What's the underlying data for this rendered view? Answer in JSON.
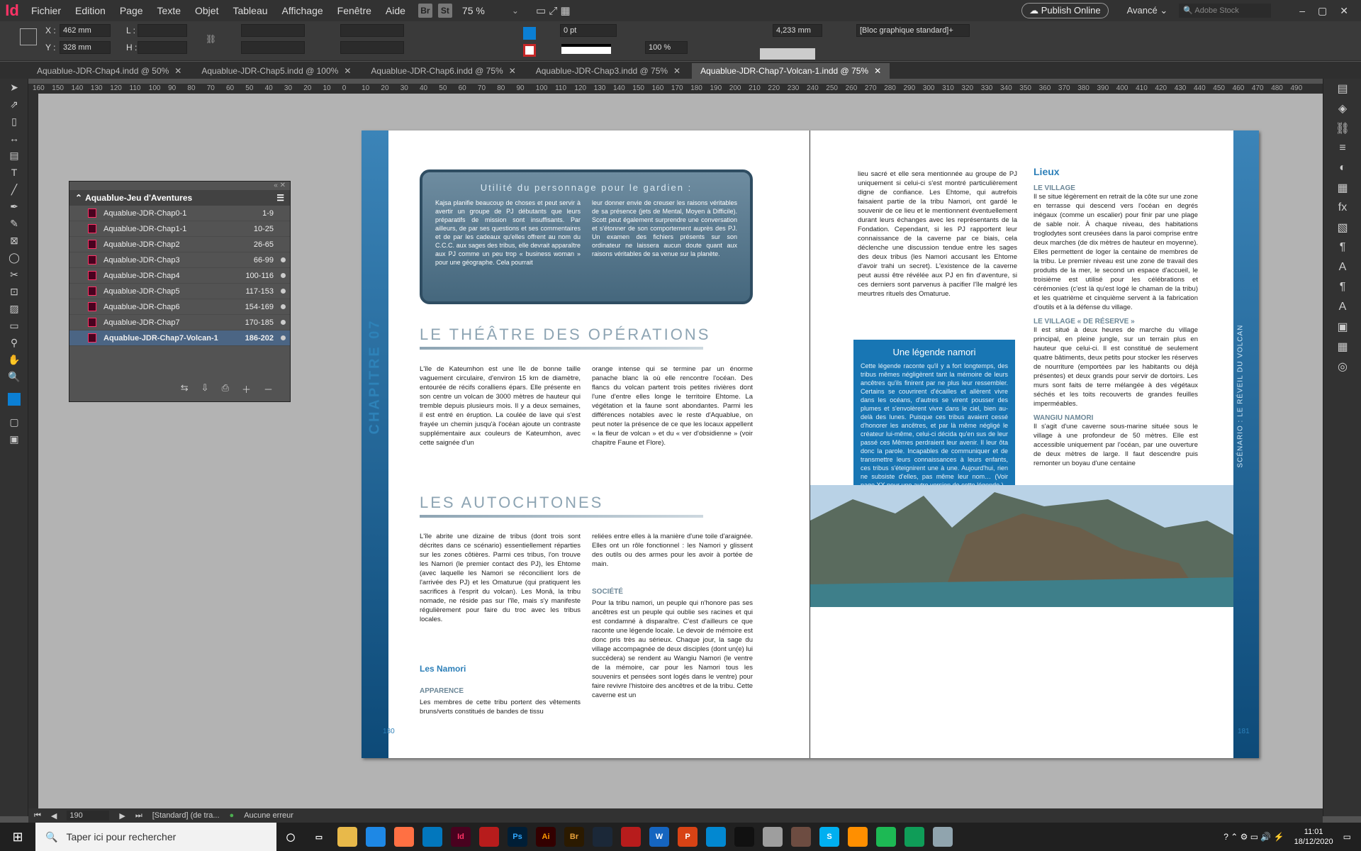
{
  "menubar": {
    "logo": "Id",
    "items": [
      "Fichier",
      "Edition",
      "Page",
      "Texte",
      "Objet",
      "Tableau",
      "Affichage",
      "Fenêtre",
      "Aide"
    ],
    "br": "Br",
    "st": "St",
    "zoom": "75 %",
    "publish": "Publish Online",
    "workspace": "Avancé",
    "stock_placeholder": "Adobe Stock"
  },
  "control": {
    "x_label": "X :",
    "x_value": "462 mm",
    "y_label": "Y :",
    "y_value": "328 mm",
    "w_label": "L :",
    "h_label": "H :",
    "stroke_weight": "0 pt",
    "scale": "100 %",
    "size_value": "4,233 mm",
    "style": "[Bloc graphique standard]+"
  },
  "tabs": [
    {
      "label": "Aquablue-JDR-Chap4.indd @ 50%"
    },
    {
      "label": "Aquablue-JDR-Chap5.indd @ 100%"
    },
    {
      "label": "Aquablue-JDR-Chap6.indd @ 75%"
    },
    {
      "label": "Aquablue-JDR-Chap3.indd @ 75%"
    },
    {
      "label": "Aquablue-JDR-Chap7-Volcan-1.indd @ 75%"
    }
  ],
  "ruler": [
    "160",
    "150",
    "140",
    "130",
    "120",
    "110",
    "100",
    "90",
    "80",
    "70",
    "60",
    "50",
    "40",
    "30",
    "20",
    "10",
    "0",
    "10",
    "20",
    "30",
    "40",
    "50",
    "60",
    "70",
    "80",
    "90",
    "100",
    "110",
    "120",
    "130",
    "140",
    "150",
    "160",
    "170",
    "180",
    "190",
    "200",
    "210",
    "220",
    "230",
    "240",
    "250",
    "260",
    "270",
    "280",
    "290",
    "300",
    "310",
    "320",
    "330",
    "340",
    "350",
    "360",
    "370",
    "380",
    "390",
    "400",
    "410",
    "420",
    "430",
    "440",
    "450",
    "460",
    "470",
    "480",
    "490"
  ],
  "book": {
    "title": "Aquablue-Jeu d'Aventures",
    "rows": [
      {
        "name": "Aquablue-JDR-Chap0-1",
        "pages": "1-9"
      },
      {
        "name": "Aquablue-JDR-Chap1-1",
        "pages": "10-25"
      },
      {
        "name": "Aquablue-JDR-Chap2",
        "pages": "26-65"
      },
      {
        "name": "Aquablue-JDR-Chap3",
        "pages": "66-99"
      },
      {
        "name": "Aquablue-JDR-Chap4",
        "pages": "100-116"
      },
      {
        "name": "Aquablue-JDR-Chap5",
        "pages": "117-153"
      },
      {
        "name": "Aquablue-JDR-Chap6",
        "pages": "154-169"
      },
      {
        "name": "Aquablue-JDR-Chap7",
        "pages": "170-185"
      },
      {
        "name": "Aquablue-JDR-Chap7-Volcan-1",
        "pages": "186-202"
      }
    ]
  },
  "page_left": {
    "chapter": "CHAPITRE 07",
    "box_title": "Utilité du personnage pour le gardien :",
    "box_col1": "Kajsa planifie beaucoup de choses et peut servir à avertir un groupe de PJ débutants que leurs préparatifs de mission sont insuffisants. Par ailleurs, de par ses questions et ses commentaires et de par les cadeaux qu'elles offrent au nom du C.C.C. aux sages des tribus, elle devrait apparaître aux PJ comme un peu trop « business woman » pour une géographe. Cela pourrait",
    "box_col2": "leur donner envie de creuser les raisons véritables de sa présence (jets de Mental, Moyen à Difficile). Scott peut également surprendre une conversation et s'étonner de son comportement auprès des PJ. Un examen des fichiers présents sur son ordinateur ne laissera aucun doute quant aux raisons véritables de sa venue sur la planète.",
    "h_theatre": "Le théâtre des opérations",
    "theatre_col1": "L'île de Kateumhon est une île de bonne taille vaguement circulaire, d'environ 15 km de diamètre, entourée de récifs coralliens épars. Elle présente en son centre un volcan de 3000 mètres de hauteur qui tremble depuis plusieurs mois. Il y a deux semaines, il est entré en éruption. La coulée de lave qui s'est frayée un chemin jusqu'à l'océan ajoute un contraste supplémentaire aux couleurs de Kateumhon, avec cette saignée d'un",
    "theatre_col2": "orange intense qui se termine par un énorme panache blanc là où elle rencontre l'océan. Des flancs du volcan partent trois petites rivières dont l'une d'entre elles longe le territoire Ehtome. La végétation et la faune sont abondantes. Parmi les différences notables avec le reste d'Aquablue, on peut noter la présence de ce que les locaux appellent « la fleur de volcan » et du « ver d'obsidienne » (voir chapitre Faune et Flore).",
    "h_autochtones": "Les autochtones",
    "auto_col1": "L'île abrite une dizaine de tribus (dont trois sont décrites dans ce scénario) essentiellement réparties sur les zones côtières. Parmi ces tribus, l'on trouve les Namori (le premier contact des PJ), les Ehtome (avec laquelle les Namori se réconcilient lors de l'arrivée des PJ) et les Omaturue (qui pratiquent les sacrifices à l'esprit du volcan). Les Monâ, la tribu nomade, ne réside pas sur l'île, mais s'y manifeste régulièrement pour faire du troc avec les tribus locales.",
    "auto_col2": "reliées entre elles à la manière d'une toile d'araignée. Elles ont un rôle fonctionnel : les Namori y glissent des outils ou des armes pour les avoir à portée de main.",
    "h_namori": "Les Namori",
    "h_apparence": "Apparence",
    "apparence": "Les membres de cette tribu portent des vêtements bruns/verts constitués de bandes de tissu",
    "h_societe": "Société",
    "societe": "Pour la tribu namori, un peuple qui n'honore pas ses ancêtres est un peuple qui oublie ses racines et qui est condamné à disparaître. C'est d'ailleurs ce que raconte une légende locale. Le devoir de mémoire est donc pris très au sérieux. Chaque jour, la sage du village accompagnée de deux disciples (dont un(e) lui succédera) se rendent au Wangiu Namori (le ventre de la mémoire, car pour les Namori tous les souvenirs et pensées sont logés dans le ventre) pour faire revivre l'histoire des ancêtres et de la tribu. Cette caverne est un",
    "page_number": "180"
  },
  "page_right": {
    "side_title": "Scénario : Le réveil du volcan",
    "col1": "lieu sacré et elle sera mentionnée au groupe de PJ uniquement si celui-ci s'est montré particulièrement digne de confiance. Les Ehtome, qui autrefois faisaient partie de la tribu Namori, ont gardé le souvenir de ce lieu et le mentionnent éventuellement durant leurs échanges avec les représentants de la Fondation. Cependant, si les PJ rapportent leur connaissance de la caverne par ce biais, cela déclenche une discussion tendue entre les sages des deux tribus (les Namori accusant les Ehtome d'avoir trahi un secret). L'existence de la caverne peut aussi être révélée aux PJ en fin d'aventure, si ces derniers sont parvenus à pacifier l'île malgré les meurtres rituels des Omaturue.",
    "legend_title": "Une légende namori",
    "legend_text": "Cette légende raconte qu'il y a fort longtemps, des tribus mêmes négligèrent tant la mémoire de leurs ancêtres qu'ils finirent par ne plus leur ressembler. Certains se couvrirent d'écailles et allèrent vivre dans les océans, d'autres se virent pousser des plumes et s'envolèrent vivre dans le ciel, bien au-delà des lunes. Puisque ces tribus avaient cessé d'honorer les ancêtres, et par là même négligé le créateur lui-même, celui-ci décida qu'en sus de leur passé ces Mêmes perdraient leur avenir. Il leur ôta donc la parole. Incapables de communiquer et de transmettre leurs connaissances à leurs enfants, ces tribus s'éteignirent une à une. Aujourd'hui, rien ne subsiste d'elles, pas même leur nom… (Voir page XX pour une autre version de cette légende.)",
    "h_lieux": "Lieux",
    "h_village": "Le village",
    "village": "Il se situe légèrement en retrait de la côte sur une zone en terrasse qui descend vers l'océan en degrés inégaux (comme un escalier) pour finir par une plage de sable noir. À chaque niveau, des habitations troglodytes sont creusées dans la paroi comprise entre deux marches (de dix mètres de hauteur en moyenne). Elles permettent de loger la centaine de membres de la tribu. Le premier niveau est une zone de travail des produits de la mer, le second un espace d'accueil, le troisième est utilisé pour les célébrations et cérémonies (c'est là qu'est logé le chaman de la tribu) et les quatrième et cinquième servent à la fabrication d'outils et à la défense du village.",
    "h_reserve": "Le village « de réserve »",
    "reserve": "Il est situé à deux heures de marche du village principal, en pleine jungle, sur un terrain plus en hauteur que celui-ci. Il est constitué de seulement quatre bâtiments, deux petits pour stocker les réserves de nourriture (emportées par les habitants ou déjà présentes) et deux grands pour servir de dortoirs. Les murs sont faits de terre mélangée à des végétaux séchés et les toits recouverts de grandes feuilles imperméables.",
    "h_wangiu": "Wangiu Namori",
    "wangiu": "Il s'agit d'une caverne sous-marine située sous le village à une profondeur de 50 mètres. Elle est accessible uniquement par l'océan, par une ouverture de deux mètres de large. Il faut descendre puis remonter un boyau d'une centaine",
    "page_number": "181"
  },
  "status": {
    "page": "190",
    "style": "[Standard] (de tra...",
    "errors": "Aucune erreur"
  },
  "taskbar": {
    "search": "Taper ici pour rechercher",
    "time": "11:01",
    "date": "18/12/2020"
  }
}
